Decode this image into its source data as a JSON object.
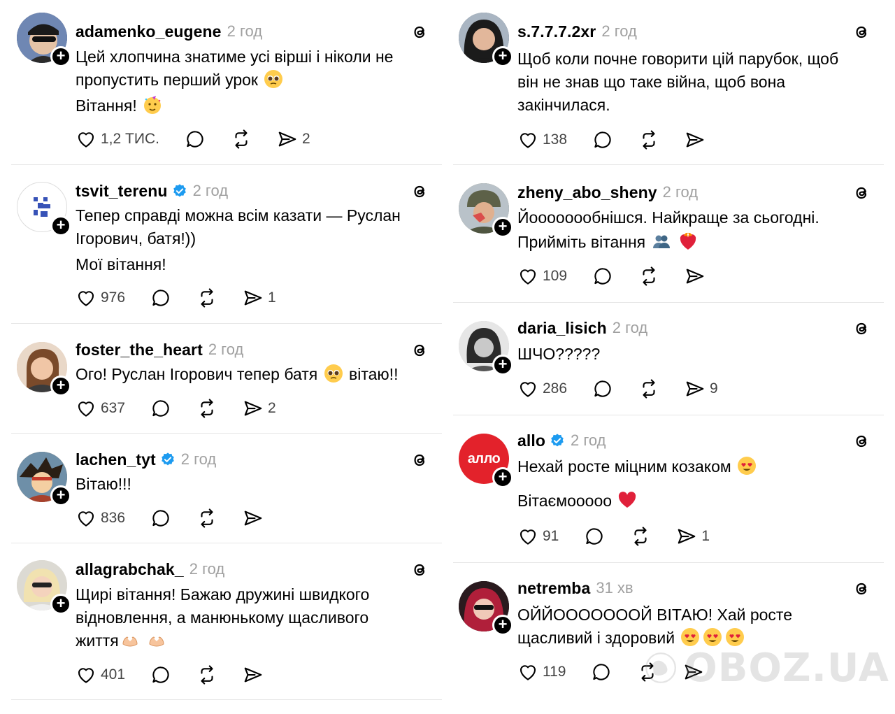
{
  "left_posts": [
    {
      "username": "adamenko_eugene",
      "verified": false,
      "time": "2 год",
      "text_lines": [
        "Цей хлопчина знатиме усі вірші і ніколи не",
        "пропустить перший урок",
        "Вітання!"
      ],
      "likes": "1,2 ТИС.",
      "shares": "2",
      "avatar_icon": "user-avatar-sunglasses"
    },
    {
      "username": "tsvit_terenu",
      "verified": true,
      "time": "2 год",
      "text_lines": [
        "Тепер справді можна всім казати — Руслан",
        "Ігорович, батя!))",
        "Мої вітання!"
      ],
      "likes": "976",
      "shares": "1",
      "avatar_icon": "brand-logo-avatar"
    },
    {
      "username": "foster_the_heart",
      "verified": false,
      "time": "2 год",
      "text_lines": [
        "Ого! Руслан Ігорович тепер батя",
        "вітаю!!"
      ],
      "likes": "637",
      "shares": "2",
      "avatar_icon": "user-avatar-portrait"
    },
    {
      "username": "lachen_tyt",
      "verified": true,
      "time": "2 год",
      "text_lines": [
        "Вітаю!!!"
      ],
      "likes": "836",
      "shares": "",
      "avatar_icon": "anime-avatar"
    },
    {
      "username": "allagrabchak_",
      "verified": false,
      "time": "2 год",
      "text_lines": [
        "Щирі вітання! Бажаю дружині швидкого",
        "відновлення, а манюнькому щасливого",
        "життя"
      ],
      "likes": "401",
      "shares": "",
      "avatar_icon": "user-avatar-portrait"
    }
  ],
  "right_posts": [
    {
      "username": "s.7.7.7.2xr",
      "verified": false,
      "time": "2 год",
      "text_lines": [
        "Щоб коли почне говорити цій парубок, щоб",
        "він не знав що таке війна, щоб вона",
        "закінчилася."
      ],
      "likes": "138",
      "shares": "",
      "avatar_icon": "user-avatar-portrait"
    },
    {
      "username": "zheny_abo_sheny",
      "verified": false,
      "time": "2 год",
      "text_lines": [
        "Йоооооообнішся. Найкраще за сьогодні.",
        "Прийміть вітання"
      ],
      "likes": "109",
      "shares": "",
      "avatar_icon": "soldier-avatar"
    },
    {
      "username": "daria_lisich",
      "verified": false,
      "time": "2 год",
      "text_lines": [
        "ШЧО?????"
      ],
      "likes": "286",
      "shares": "9",
      "avatar_icon": "user-avatar-portrait"
    },
    {
      "username": "allo",
      "verified": true,
      "time": "2 год",
      "text_lines": [
        "Нехай росте міцним козаком",
        "Вітаємоoooo"
      ],
      "likes": "91",
      "shares": "1",
      "avatar_icon": "allo-logo",
      "avatar_text": "алло"
    },
    {
      "username": "netremba",
      "verified": false,
      "time": "31 хв",
      "text_lines": [
        "ОЙЙОООООООЙ ВІТАЮ! Хай росте",
        "щасливий і здоровий"
      ],
      "likes": "119",
      "shares": "",
      "avatar_icon": "user-avatar-portrait"
    }
  ],
  "watermark": {
    "text": "OBOZ.UA"
  },
  "colors": {
    "verified": "#1d9bf0",
    "allo_red": "#e3222b",
    "timestamp": "#a0a0a0"
  }
}
